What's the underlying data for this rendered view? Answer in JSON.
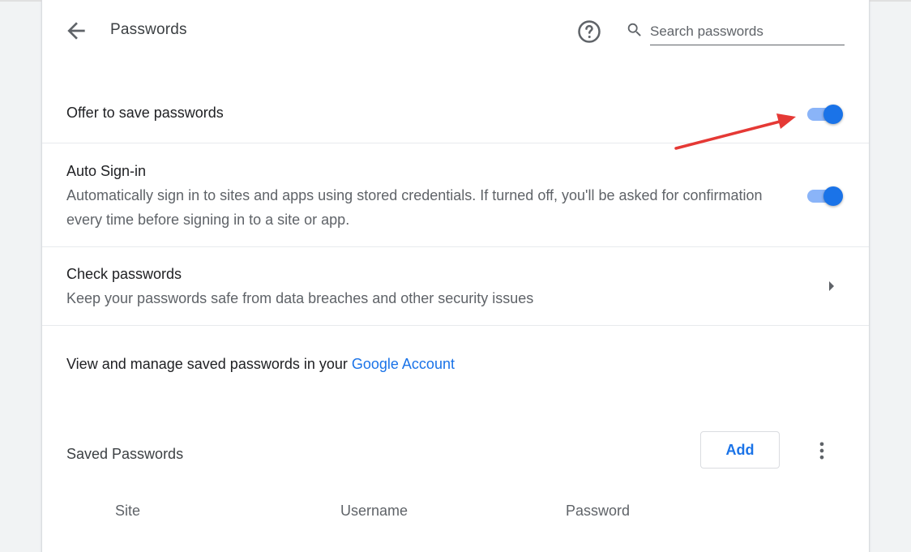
{
  "header": {
    "title": "Passwords",
    "search_placeholder": "Search passwords"
  },
  "settings": {
    "offer_save": {
      "title": "Offer to save passwords",
      "enabled": true
    },
    "auto_signin": {
      "title": "Auto Sign-in",
      "description": "Automatically sign in to sites and apps using stored credentials. If turned off, you'll be asked for confirmation every time before signing in to a site or app.",
      "enabled": true
    },
    "check_passwords": {
      "title": "Check passwords",
      "description": "Keep your passwords safe from data breaches and other security issues"
    }
  },
  "manage": {
    "text": "View and manage saved passwords in your ",
    "link_label": "Google Account"
  },
  "saved_passwords": {
    "title": "Saved Passwords",
    "add_label": "Add",
    "columns": [
      "Site",
      "Username",
      "Password"
    ]
  },
  "icons": {
    "back": "arrow-back-icon",
    "help": "help-icon",
    "search": "search-icon",
    "chevron": "chevron-right-icon",
    "more": "more-vert-icon"
  },
  "colors": {
    "accent": "#1a73e8",
    "toggle_track": "#8ab4f8",
    "annotation_arrow": "#e53935"
  }
}
